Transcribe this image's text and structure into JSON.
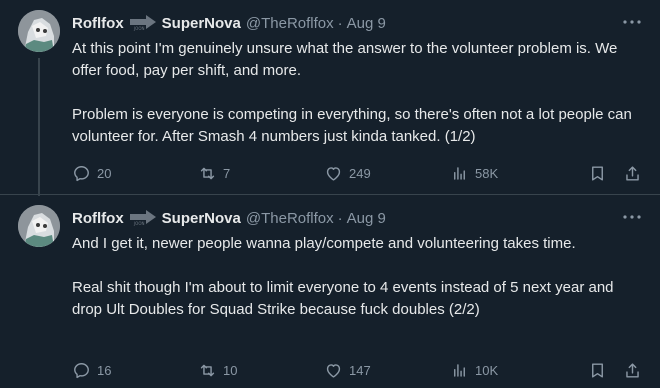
{
  "tweets": [
    {
      "author_name": "Roflfox",
      "badge_icon": "reposted-arrow-icon",
      "secondary_name": "SuperNova",
      "handle": "@TheRoflfox",
      "separator": "·",
      "date": "Aug 9",
      "paragraphs": [
        "At this point I'm genuinely unsure what the answer to the volunteer problem is. We offer food, pay per shift, and more.",
        "Problem is everyone is competing in everything, so there's often not a lot people can volunteer for. After Smash 4 numbers just kinda tanked. (1/2)"
      ],
      "replies": "20",
      "retweets": "7",
      "likes": "249",
      "views": "58K"
    },
    {
      "author_name": "Roflfox",
      "badge_icon": "reposted-arrow-icon",
      "secondary_name": "SuperNova",
      "handle": "@TheRoflfox",
      "separator": "·",
      "date": "Aug 9",
      "paragraphs": [
        "And I get it, newer people wanna play/compete and volunteering takes time.",
        "Real shit though I'm about to limit everyone to 4 events instead of 5 next year and drop Ult Doubles for Squad Strike because fuck doubles (2/2)"
      ],
      "replies": "16",
      "retweets": "10",
      "likes": "147",
      "views": "10K"
    }
  ],
  "colors": {
    "background": "#15202b",
    "text": "#e7e9ea",
    "muted": "#8b98a5",
    "divider": "#38444d"
  }
}
